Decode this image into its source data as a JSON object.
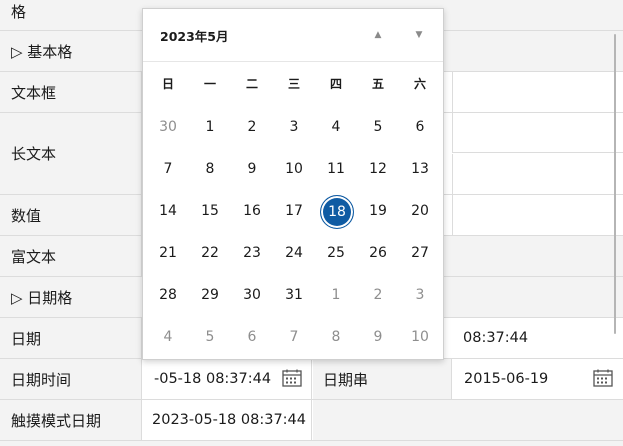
{
  "rows": {
    "header_label": "格",
    "basic_group": "▷ 基本格",
    "textbox": "文本框",
    "longtext": "长文本",
    "number": "数值",
    "richtext": "富文本",
    "date_group": "▷ 日期格",
    "date": "日期",
    "date_value": "08:37:44",
    "datetime": "日期时间",
    "datetime_value": "-05-18 08:37:44",
    "datestring": "日期串",
    "datestring_value": "2015-06-19",
    "touch_date": "触摸模式日期",
    "touch_date_value": "2023-05-18 08:37:44"
  },
  "calendar": {
    "title": "2023年5月",
    "weekdays": [
      "日",
      "一",
      "二",
      "三",
      "四",
      "五",
      "六"
    ],
    "weeks": [
      [
        {
          "d": "30",
          "dim": true
        },
        {
          "d": "1"
        },
        {
          "d": "2"
        },
        {
          "d": "3"
        },
        {
          "d": "4"
        },
        {
          "d": "5"
        },
        {
          "d": "6"
        }
      ],
      [
        {
          "d": "7"
        },
        {
          "d": "8"
        },
        {
          "d": "9"
        },
        {
          "d": "10"
        },
        {
          "d": "11"
        },
        {
          "d": "12"
        },
        {
          "d": "13"
        }
      ],
      [
        {
          "d": "14"
        },
        {
          "d": "15"
        },
        {
          "d": "16"
        },
        {
          "d": "17"
        },
        {
          "d": "18",
          "sel": true
        },
        {
          "d": "19"
        },
        {
          "d": "20"
        }
      ],
      [
        {
          "d": "21"
        },
        {
          "d": "22"
        },
        {
          "d": "23"
        },
        {
          "d": "24"
        },
        {
          "d": "25"
        },
        {
          "d": "26"
        },
        {
          "d": "27"
        }
      ],
      [
        {
          "d": "28"
        },
        {
          "d": "29"
        },
        {
          "d": "30"
        },
        {
          "d": "31"
        },
        {
          "d": "1",
          "dim": true
        },
        {
          "d": "2",
          "dim": true
        },
        {
          "d": "3",
          "dim": true
        }
      ],
      [
        {
          "d": "4",
          "dim": true
        },
        {
          "d": "5",
          "dim": true
        },
        {
          "d": "6",
          "dim": true
        },
        {
          "d": "7",
          "dim": true
        },
        {
          "d": "8",
          "dim": true
        },
        {
          "d": "9",
          "dim": true
        },
        {
          "d": "10",
          "dim": true
        }
      ]
    ],
    "accent": "#0f5ba3"
  }
}
